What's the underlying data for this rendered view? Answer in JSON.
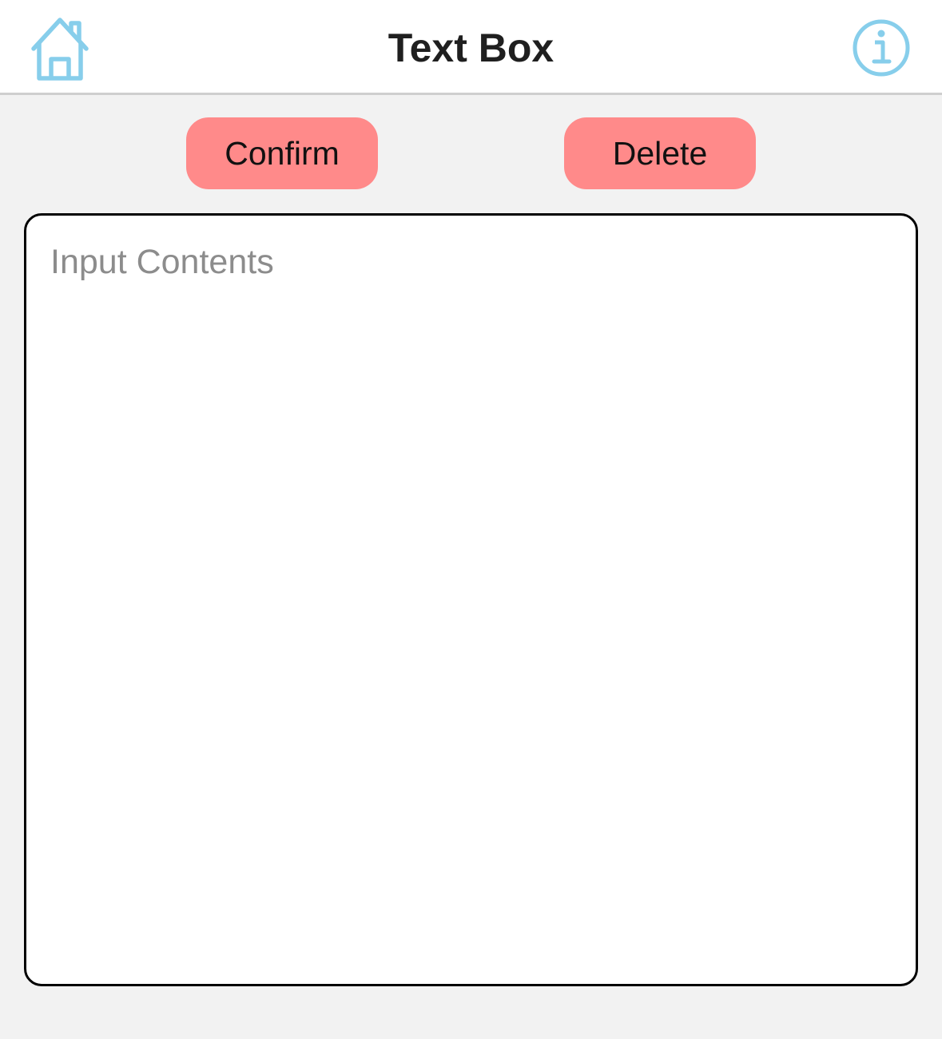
{
  "header": {
    "title": "Text Box",
    "left_icon": "home-icon",
    "right_icon": "info-icon"
  },
  "actions": {
    "confirm_label": "Confirm",
    "delete_label": "Delete"
  },
  "editor": {
    "value": "",
    "placeholder": "Input Contents"
  },
  "colors": {
    "accent": "#87ceeb",
    "button": "#ff8a8a",
    "background": "#f2f2f2",
    "navbar": "#ffffff"
  }
}
